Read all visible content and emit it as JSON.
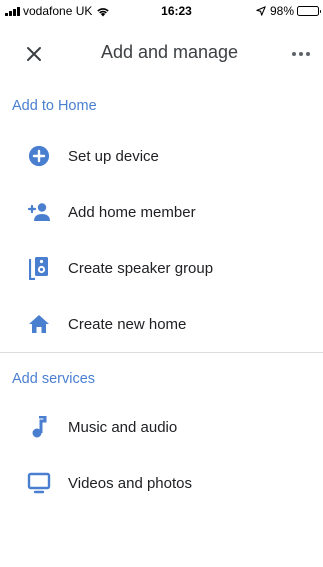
{
  "status_bar": {
    "carrier": "vodafone UK",
    "time": "16:23",
    "battery": "98%",
    "battery_level_percent": 98
  },
  "app_bar": {
    "title": "Add and manage",
    "close_icon": "close-icon",
    "more_icon": "more-horizontal-icon"
  },
  "sections": [
    {
      "title": "Add to Home",
      "items": [
        {
          "label": "Set up device",
          "icon": "add-circle-icon"
        },
        {
          "label": "Add home member",
          "icon": "person-add-icon"
        },
        {
          "label": "Create speaker group",
          "icon": "speaker-icon"
        },
        {
          "label": "Create new home",
          "icon": "home-icon"
        }
      ]
    },
    {
      "title": "Add services",
      "items": [
        {
          "label": "Music and audio",
          "icon": "music-note-icon"
        },
        {
          "label": "Videos and photos",
          "icon": "tv-icon"
        }
      ]
    }
  ],
  "colors": {
    "accent": "#4a7fd0",
    "icon_blue": "#1a73e8",
    "text": "#202124",
    "divider": "#dadce0"
  }
}
